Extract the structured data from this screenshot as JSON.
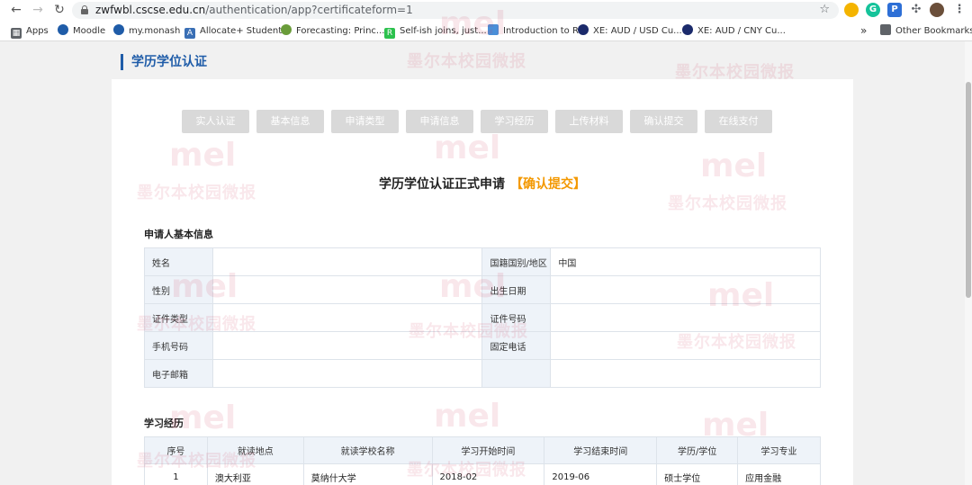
{
  "browser": {
    "url_host": "zwfwbl.cscse.edu.cn",
    "url_path": "/authentication/app?certificateform=1",
    "bookmarks": [
      {
        "label": "Apps"
      },
      {
        "label": "Moodle"
      },
      {
        "label": "my.monash"
      },
      {
        "label": "Allocate+ Student"
      },
      {
        "label": "Forecasting: Princ..."
      },
      {
        "label": "Self-ish joins, just..."
      },
      {
        "label": "Introduction to R"
      },
      {
        "label": "XE: AUD / USD Cu..."
      },
      {
        "label": "XE: AUD / CNY Cu..."
      }
    ],
    "more_bookmarks": "»",
    "other_bookmarks": "Other Bookmarks"
  },
  "page": {
    "section_title": "学历学位认证",
    "steps": [
      "实人认证",
      "基本信息",
      "申请类型",
      "申请信息",
      "学习经历",
      "上传材料",
      "确认提交",
      "在线支付"
    ],
    "form_title": "学历学位认证正式申请",
    "form_status": "【确认提交】",
    "applicant_section": "申请人基本信息",
    "applicant": {
      "name_label": "姓名",
      "name_value": "",
      "nationality_label": "国籍国别/地区",
      "nationality_value": "中国",
      "gender_label": "性别",
      "gender_value": "",
      "birth_label": "出生日期",
      "birth_value": "",
      "id_type_label": "证件类型",
      "id_type_value": "",
      "id_no_label": "证件号码",
      "id_no_value": "",
      "mobile_label": "手机号码",
      "mobile_value": "",
      "phone_label": "固定电话",
      "phone_value": "",
      "email_label": "电子邮箱",
      "email_value": ""
    },
    "education_section": "学习经历",
    "education": {
      "headers": [
        "序号",
        "就读地点",
        "就读学校名称",
        "学习开始时间",
        "学习结束时间",
        "学历/学位",
        "学习专业"
      ],
      "rows": [
        [
          "1",
          "澳大利亚",
          "莫纳什大学",
          "2018-02",
          "2019-06",
          "硕士学位",
          "应用金融"
        ]
      ]
    },
    "watermark_text": "墨尔本校园微报",
    "watermark_logo": "mel"
  }
}
